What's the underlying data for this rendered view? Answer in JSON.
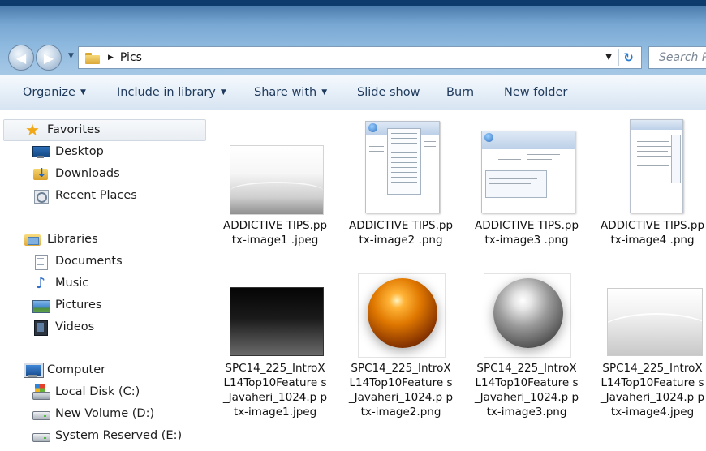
{
  "window": {
    "address": {
      "current_folder": "Pics"
    },
    "search": {
      "placeholder": "Search Pics"
    }
  },
  "toolbar": {
    "organize": "Organize",
    "include_in_library": "Include in library",
    "share_with": "Share with",
    "slide_show": "Slide show",
    "burn": "Burn",
    "new_folder": "New folder"
  },
  "nav": {
    "favorites": {
      "label": "Favorites",
      "items": [
        "Desktop",
        "Downloads",
        "Recent Places"
      ]
    },
    "libraries": {
      "label": "Libraries",
      "items": [
        "Documents",
        "Music",
        "Pictures",
        "Videos"
      ]
    },
    "computer": {
      "label": "Computer",
      "items": [
        "Local Disk (C:)",
        "New Volume (D:)",
        "System Reserved (E:)"
      ]
    }
  },
  "files": [
    {
      "name": "ADDICTIVE TIPS.pptx-image1 .jpeg"
    },
    {
      "name": "ADDICTIVE TIPS.pptx-image2 .png"
    },
    {
      "name": "ADDICTIVE TIPS.pptx-image3 .png"
    },
    {
      "name": "ADDICTIVE TIPS.pptx-image4 .png"
    },
    {
      "name": "SPC14_225_IntroX L14Top10Feature s_Javaheri_1024.p ptx-image1.jpeg"
    },
    {
      "name": "SPC14_225_IntroX L14Top10Feature s_Javaheri_1024.p ptx-image2.png"
    },
    {
      "name": "SPC14_225_IntroX L14Top10Feature s_Javaheri_1024.p ptx-image3.png"
    },
    {
      "name": "SPC14_225_IntroX L14Top10Feature s_Javaheri_1024.p ptx-image4.jpeg"
    }
  ],
  "icons": {
    "back": "back-arrow-icon",
    "forward": "forward-arrow-icon",
    "refresh": "refresh-icon",
    "favorites": "star-icon"
  },
  "colors": {
    "title_bar": "#4c7ead",
    "command_bar": "#e6eff8",
    "text": "#1e395b"
  }
}
